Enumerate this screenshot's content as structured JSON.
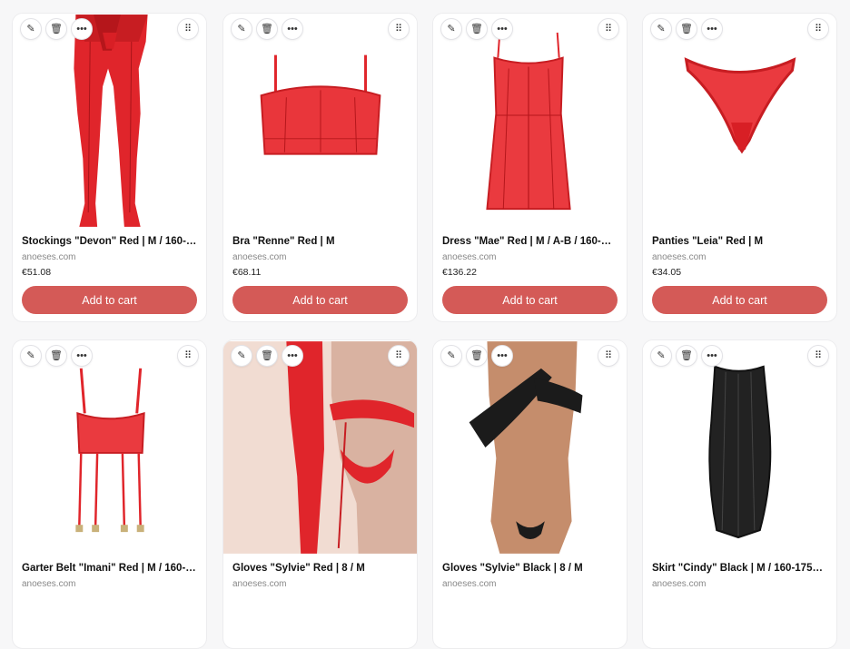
{
  "accent_color": "#d45a57",
  "icons": {
    "edit": "✎",
    "delete": "🗑",
    "more": "•••",
    "drag": "⠿"
  },
  "products": [
    {
      "title": "Stockings \"Devon\" Red | M / 160-…",
      "domain": "anoeses.com",
      "price": "€51.08",
      "cta": "Add to cart",
      "image": "red-stockings-legs"
    },
    {
      "title": "Bra \"Renne\" Red | M",
      "domain": "anoeses.com",
      "price": "€68.11",
      "cta": "Add to cart",
      "image": "red-mesh-bra"
    },
    {
      "title": "Dress \"Mae\" Red | M / A-B / 160-…",
      "domain": "anoeses.com",
      "price": "€136.22",
      "cta": "Add to cart",
      "image": "red-mesh-dress"
    },
    {
      "title": "Panties \"Leia\" Red | M",
      "domain": "anoeses.com",
      "price": "€34.05",
      "cta": "Add to cart",
      "image": "red-mesh-panties"
    },
    {
      "title": "Garter Belt \"Imani\" Red | M / 160-…",
      "domain": "anoeses.com",
      "price": "",
      "cta": "",
      "image": "red-garter-belt"
    },
    {
      "title": "Gloves \"Sylvie\" Red | 8 / M",
      "domain": "anoeses.com",
      "price": "",
      "cta": "",
      "image": "red-gloves-model"
    },
    {
      "title": "Gloves \"Sylvie\" Black | 8 / M",
      "domain": "anoeses.com",
      "price": "",
      "cta": "",
      "image": "black-gloves-model"
    },
    {
      "title": "Skirt \"Cindy\" Black | M / 160-175…",
      "domain": "anoeses.com",
      "price": "",
      "cta": "",
      "image": "black-mesh-skirt"
    }
  ]
}
